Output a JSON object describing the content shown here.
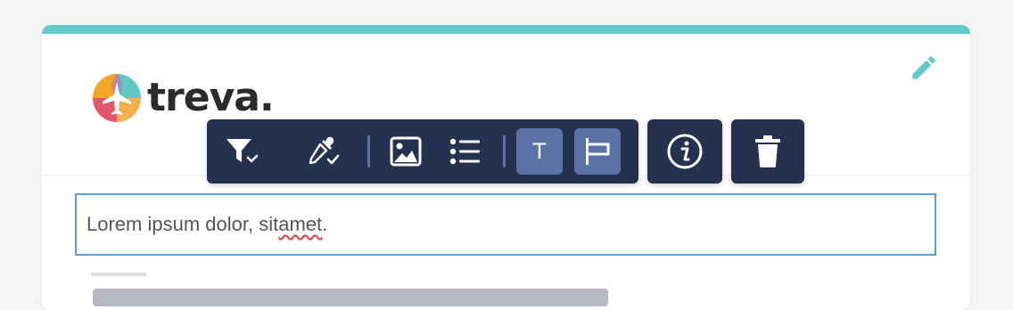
{
  "colors": {
    "accent": "#62cbc9",
    "toolbar_bg": "#243250",
    "toolbar_active": "#5a72a6",
    "focus_border": "#5a9fd6"
  },
  "logo": {
    "text": "treva."
  },
  "editor": {
    "text_prefix": "Lorem ipsum dolor, sit ",
    "text_misspelled": "amet",
    "text_suffix": "."
  },
  "toolbar": {
    "buttons": [
      {
        "icon": "filter-check-icon",
        "active": false
      },
      {
        "icon": "eyedropper-check-icon",
        "active": false
      },
      {
        "icon": "image-icon",
        "active": false
      },
      {
        "icon": "bulleted-list-icon",
        "active": false
      },
      {
        "icon": "text-icon",
        "label": "T",
        "active": true
      },
      {
        "icon": "flag-align-icon",
        "active": true
      }
    ],
    "info_icon": "info-circle-icon",
    "delete_icon": "trash-icon"
  },
  "card": {
    "edit_icon": "pencil-icon"
  }
}
